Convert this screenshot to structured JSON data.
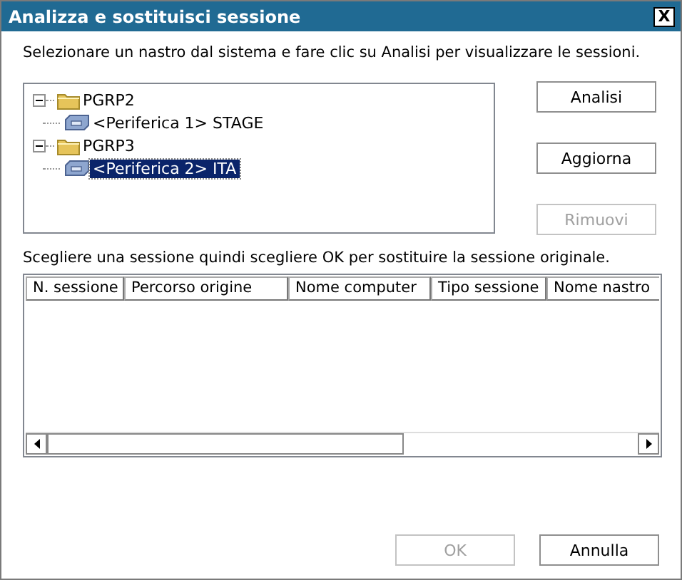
{
  "window": {
    "title": "Analizza e sostituisci sessione",
    "close": "X"
  },
  "instruction": "Selezionare un nastro dal sistema e fare clic su Analisi per visualizzare le sessioni.",
  "tree": [
    {
      "kind": "folder",
      "label": "PGRP2",
      "expanded": true,
      "selected": false,
      "children": [
        {
          "kind": "device",
          "label": "<Periferica 1> STAGE",
          "selected": false
        }
      ]
    },
    {
      "kind": "folder",
      "label": "PGRP3",
      "expanded": true,
      "selected": false,
      "children": [
        {
          "kind": "device",
          "label": "<Periferica 2> ITA",
          "selected": true
        }
      ]
    }
  ],
  "side_buttons": [
    {
      "label": "Analisi",
      "disabled": false
    },
    {
      "label": "Aggiorna",
      "disabled": false
    },
    {
      "label": "Rimuovi",
      "disabled": true
    }
  ],
  "sessions_label": "Scegliere una sessione quindi scegliere OK per sostituire la sessione originale.",
  "table": {
    "columns": [
      "N. sessione",
      "Percorso origine",
      "Nome computer",
      "Tipo sessione",
      "Nome nastro"
    ]
  },
  "buttons": [
    {
      "label": "OK",
      "disabled": true
    },
    {
      "label": "Annulla",
      "disabled": false
    }
  ]
}
